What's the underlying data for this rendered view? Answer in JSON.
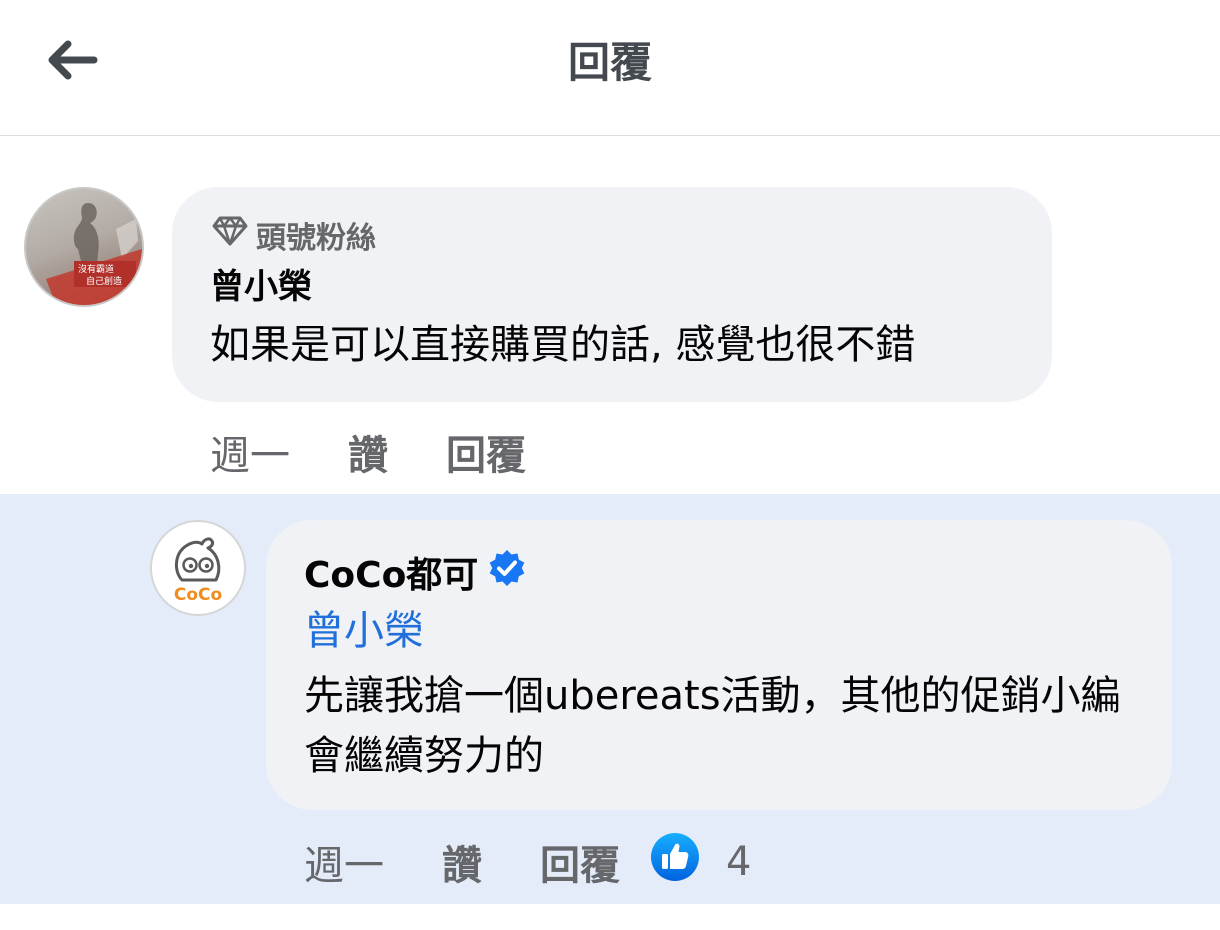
{
  "header": {
    "title": "回覆",
    "back_icon": "arrow-left-icon"
  },
  "comment": {
    "badge_icon": "diamond-icon",
    "badge": "頭號粉絲",
    "author": "曾小榮",
    "avatar_text": "沒有霸道 自己創造",
    "text": "如果是可以直接購買的話, 感覺也很不錯",
    "time": "週一",
    "like_label": "讚",
    "reply_label": "回覆"
  },
  "reply": {
    "author": "CoCo都可",
    "verified_icon": "verified-badge-icon",
    "avatar_logo_text": "CoCo",
    "mention": "曾小榮",
    "text": "先讓我搶一個ubereats活動，其他的促銷小編會繼續努力的",
    "time": "週一",
    "like_label": "讚",
    "reply_label": "回覆",
    "reaction_icon": "like-reaction-icon",
    "reaction_count": "4"
  },
  "colors": {
    "highlight_background": "#e3ecf8",
    "bubble_background": "#f0f2f5",
    "mention_color": "#216fdb",
    "verified_color": "#1877f2",
    "secondary_text": "#65676b"
  }
}
